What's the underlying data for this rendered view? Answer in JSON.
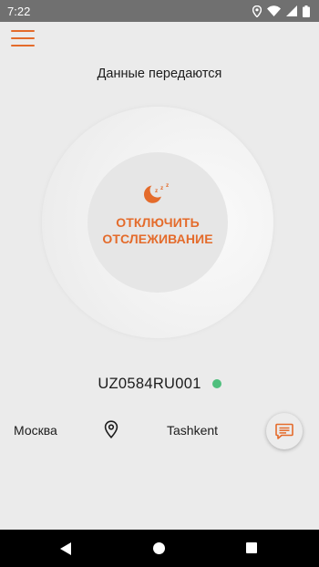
{
  "status_bar": {
    "time": "7:22",
    "icons": [
      "location-icon",
      "wifi-icon",
      "cellular-signal-icon",
      "battery-icon"
    ]
  },
  "header": {
    "menu_icon": "hamburger-menu-icon",
    "title": "Данные передаются"
  },
  "tracking_toggle": {
    "icon": "sleep-moon-icon",
    "label": "ОТКЛЮЧИТЬ\nОТСЛЕЖИВАНИЕ"
  },
  "device": {
    "id": "UZ0584RU001",
    "online": true,
    "status_color": "#4fbf7d"
  },
  "route": {
    "from": "Москва",
    "to": "Tashkent",
    "pin_icon": "location-pin-icon",
    "chat_icon": "chat-bubble-icon"
  },
  "theme": {
    "accent": "#e46b2b",
    "background": "#ebebeb",
    "status_bar": "#707070",
    "nav_bar": "#000000"
  },
  "nav_bar": {
    "icons": [
      "back-icon",
      "home-icon",
      "recents-icon"
    ]
  }
}
